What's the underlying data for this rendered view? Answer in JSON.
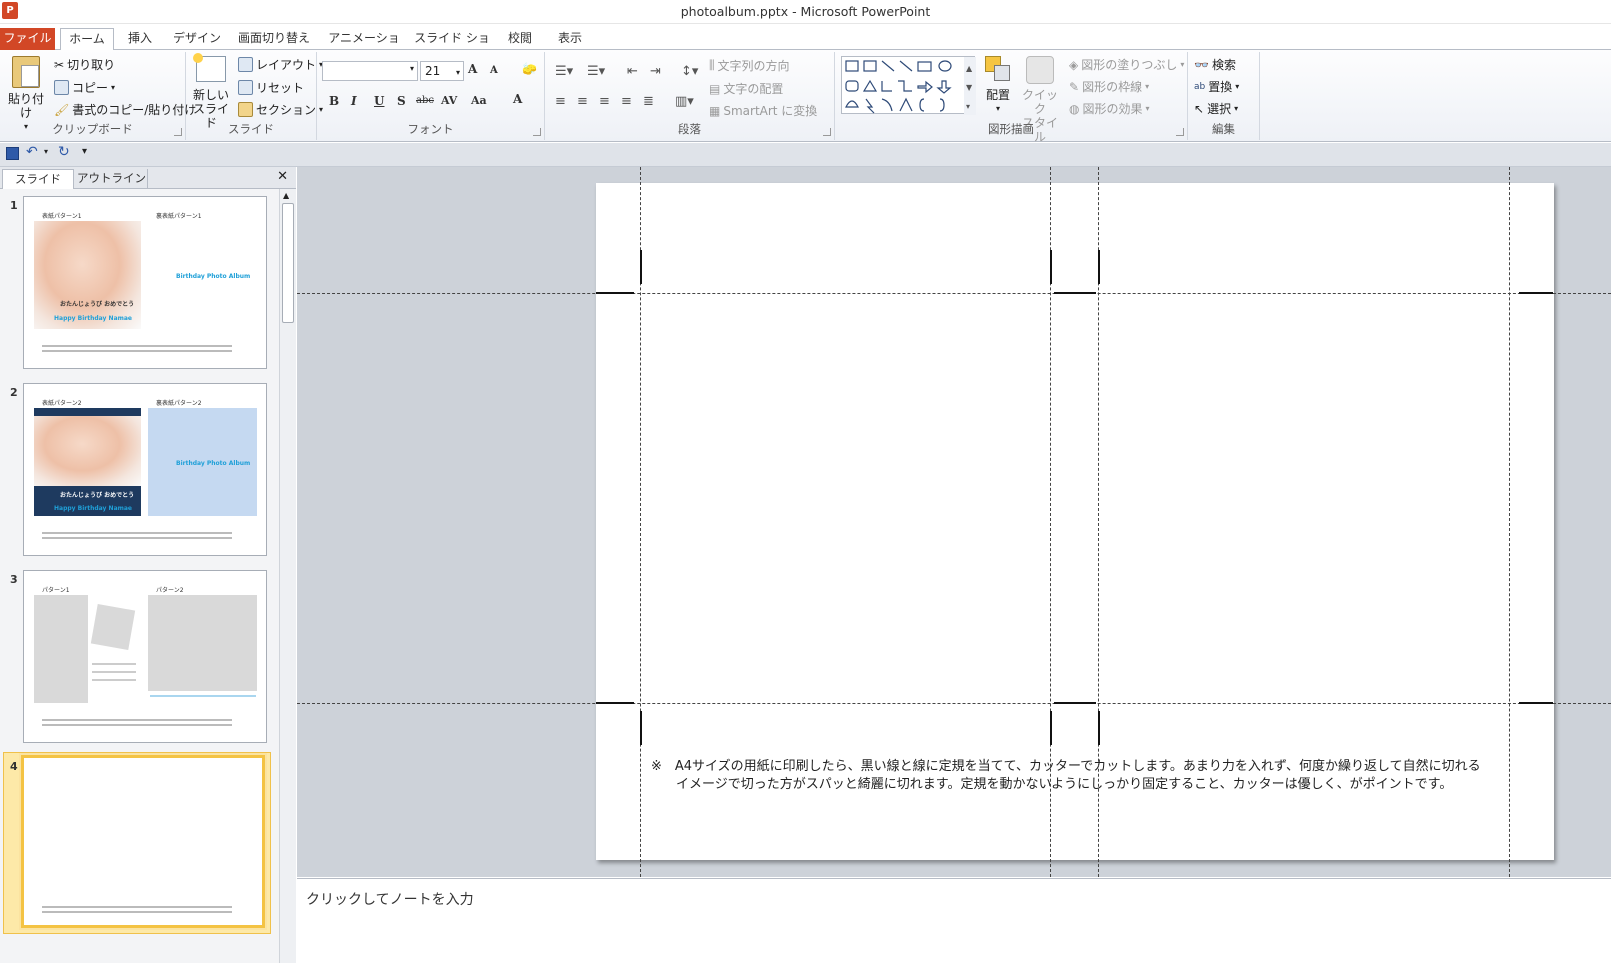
{
  "window": {
    "title": "photoalbum.pptx - Microsoft PowerPoint",
    "app_icon": "P"
  },
  "tabs": [
    "ファイル",
    "ホーム",
    "挿入",
    "デザイン",
    "画面切り替え",
    "アニメーション",
    "スライド ショー",
    "校閲",
    "表示"
  ],
  "active_tab": "ホーム",
  "ribbon": {
    "clipboard": {
      "label": "クリップボード",
      "paste": "貼り付け",
      "cut": "切り取り",
      "copy": "コピー",
      "format_painter": "書式のコピー/貼り付け"
    },
    "slides": {
      "label": "スライド",
      "new_slide_1": "新しい",
      "new_slide_2": "スライド",
      "layout": "レイアウト",
      "reset": "リセット",
      "section": "セクション"
    },
    "font": {
      "label": "フォント",
      "font_name": "",
      "font_size": "21",
      "bold": "B",
      "italic": "I",
      "underline": "U",
      "shadow": "S",
      "strike": "abc",
      "spacing": "AV",
      "case": "Aa",
      "color": "A",
      "grow": "A",
      "shrink": "A"
    },
    "paragraph": {
      "label": "段落",
      "text_direction": "文字列の方向",
      "align_text": "文字の配置",
      "smartart": "SmartArt に変換"
    },
    "drawing": {
      "label": "図形描画",
      "arrange": "配置",
      "quick_styles_1": "クイック",
      "quick_styles_2": "スタイル",
      "shape_fill": "図形の塗りつぶし",
      "shape_outline": "図形の枠線",
      "shape_effects": "図形の効果"
    },
    "editing": {
      "label": "編集",
      "find": "検索",
      "replace": "置換",
      "select": "選択"
    }
  },
  "pane_tabs": [
    "スライド",
    "アウトライン"
  ],
  "thumbnails": {
    "s1": {
      "num": "1",
      "left_title": "表紙パターン1",
      "right_title": "裏表紙パターン1",
      "album": "Birthday Photo Album",
      "msg": "おたんじょうび おめでとう",
      "happy": "Happy Birthday Namae"
    },
    "s2": {
      "num": "2",
      "left_title": "表紙パターン2",
      "right_title": "裏表紙パターン2",
      "album": "Birthday Photo Album",
      "msg": "おたんじょうび おめでとう",
      "happy": "Happy Birthday Namae"
    },
    "s3": {
      "num": "3",
      "left_title": "パターン1",
      "right_title": "パターン2"
    },
    "s4": {
      "num": "4"
    }
  },
  "slide_note_line1": "※　A4サイズの用紙に印刷したら、黒い線と線に定規を当てて、カッターでカットします。あまり力を入れず、何度か繰り返して自然に切れる",
  "slide_note_line2": "イメージで切った方がスパッと綺麗に切れます。定規を動かないようにしっかり固定すること、カッターは優しく、がポイントです。",
  "notes_placeholder": "クリックしてノートを入力",
  "colors": {
    "file_tab": "#d24726",
    "selection": "#f4c343",
    "arrow": "#e8262b",
    "navy": "#1e3a5f",
    "light_blue": "#c5d9f1",
    "album_text": "#1fa0d8"
  }
}
